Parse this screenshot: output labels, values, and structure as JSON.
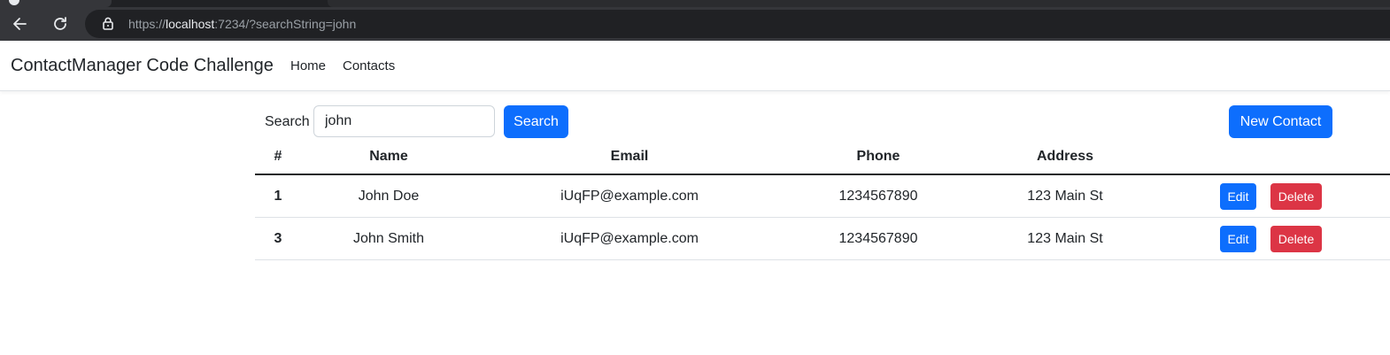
{
  "browser": {
    "url_scheme": "https://",
    "url_host": "localhost",
    "url_rest": ":7234/?searchString=john",
    "icons": [
      "back-arrow-icon",
      "reload-icon",
      "lock-icon"
    ]
  },
  "navbar": {
    "brand": "ContactManager Code Challenge",
    "links": [
      "Home",
      "Contacts"
    ]
  },
  "search": {
    "label": "Search",
    "value": "john",
    "button": "Search"
  },
  "new_contact_label": "New Contact",
  "table": {
    "headers": [
      "#",
      "Name",
      "Email",
      "Phone",
      "Address"
    ],
    "rows": [
      {
        "num": "1",
        "name": "John Doe",
        "email": "iUqFP@example.com",
        "phone": "1234567890",
        "address": "123 Main St"
      },
      {
        "num": "3",
        "name": "John Smith",
        "email": "iUqFP@example.com",
        "phone": "1234567890",
        "address": "123 Main St"
      }
    ],
    "edit_label": "Edit",
    "delete_label": "Delete"
  },
  "colors": {
    "primary": "#0d6efd",
    "danger": "#dc3545"
  }
}
